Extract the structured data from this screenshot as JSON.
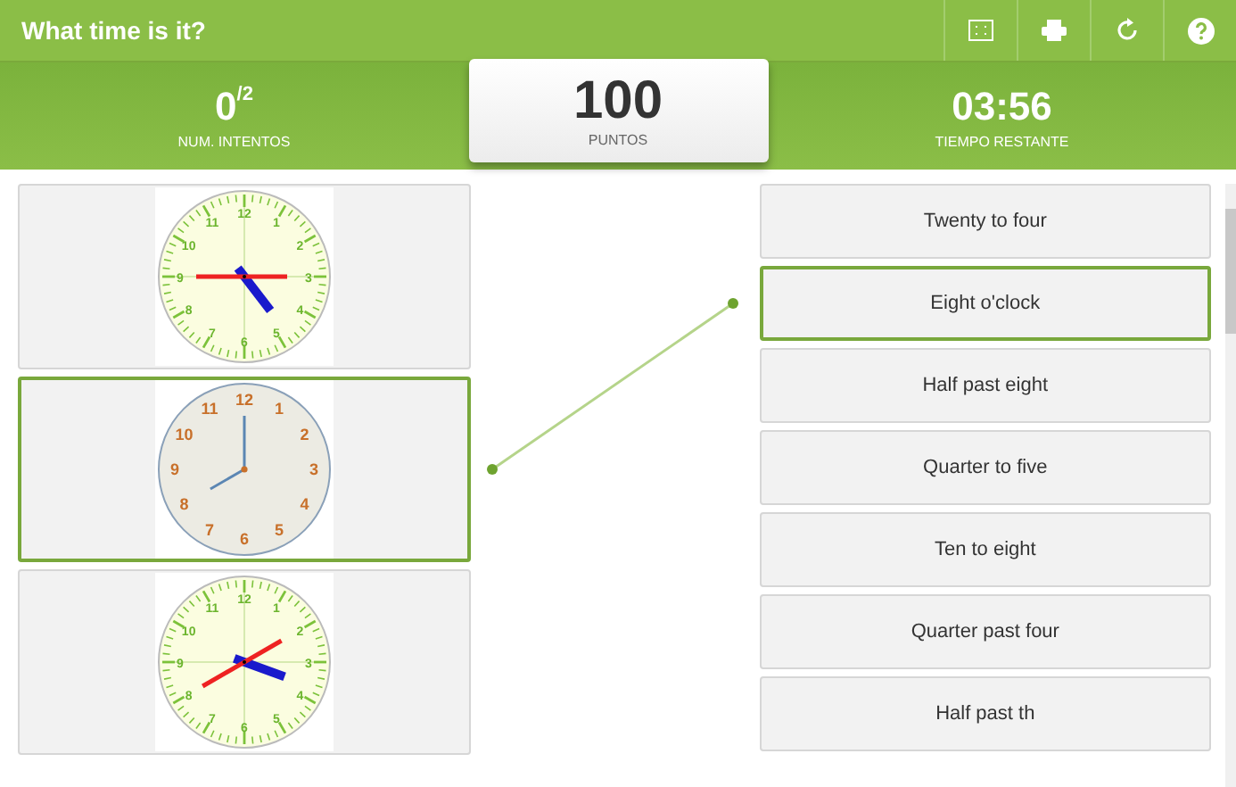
{
  "window": {
    "title": "What time is it?"
  },
  "toolbar": [
    {
      "kind": "fullscreen"
    },
    {
      "kind": "print"
    },
    {
      "kind": "restart"
    },
    {
      "kind": "help"
    }
  ],
  "stats": {
    "attempts": {
      "value": "0",
      "total": "/2",
      "label": "NUM. INTENTOS"
    },
    "score": {
      "value": "100",
      "label": "PUNTOS"
    },
    "time": {
      "value": "03:56",
      "label": "TIEMPO RESTANTE"
    }
  },
  "clocks": [
    {
      "kind": "green",
      "selected": false,
      "numerals": [
        "12",
        "1",
        "2",
        "3",
        "4",
        "5",
        "6",
        "7",
        "8",
        "9",
        "10",
        "11"
      ]
    },
    {
      "kind": "beige",
      "selected": true,
      "numerals": [
        "12",
        "1",
        "2",
        "3",
        "4",
        "5",
        "6",
        "7",
        "8",
        "9",
        "10",
        "11"
      ]
    },
    {
      "kind": "green",
      "selected": false,
      "numerals": [
        "12",
        "1",
        "2",
        "3",
        "4",
        "5",
        "6",
        "7",
        "8",
        "9",
        "10",
        "11"
      ]
    }
  ],
  "answers": [
    {
      "label": "Twenty to four",
      "selected": false
    },
    {
      "label": "Eight o'clock",
      "selected": true
    },
    {
      "label": "Half past eight",
      "selected": false
    },
    {
      "label": "Quarter to five",
      "selected": false
    },
    {
      "label": "Ten to eight",
      "selected": false
    },
    {
      "label": "Quarter past four",
      "selected": false
    },
    {
      "label": "Half past th",
      "selected": false
    }
  ]
}
